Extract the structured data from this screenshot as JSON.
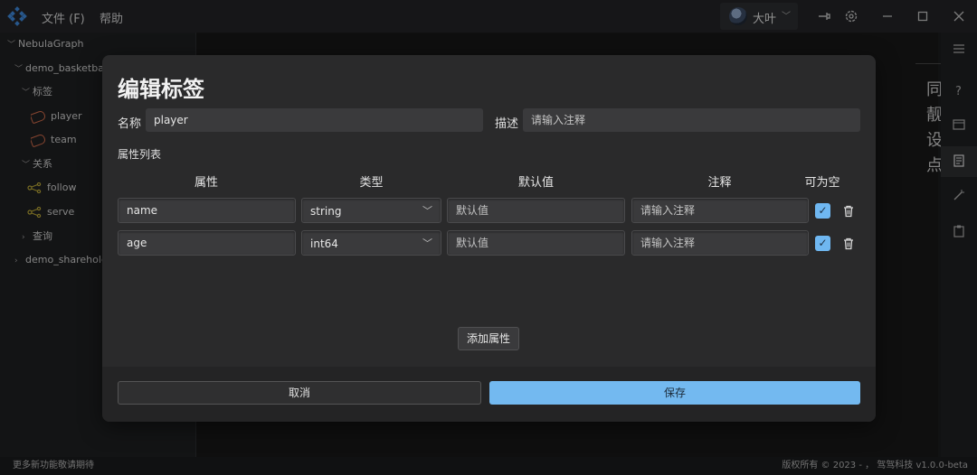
{
  "menu": {
    "file": "文件 (F)",
    "help": "帮助"
  },
  "user": {
    "name": "大叶"
  },
  "sidebar": {
    "root": "NebulaGraph",
    "space1": "demo_basketball",
    "tags_group": "标签",
    "tag1": "player",
    "tag2": "team",
    "edges_group": "关系",
    "edge1": "follow",
    "edge2": "serve",
    "query_group": "查询",
    "space2": "demo_shareholding"
  },
  "background_glyphs": [
    "同",
    "靓",
    "设",
    "点"
  ],
  "dialog": {
    "title": "编辑标签",
    "name_label": "名称",
    "name_value": "player",
    "desc_label": "描述",
    "desc_placeholder": "请输入注释",
    "props_label": "属性列表",
    "columns": [
      "属性",
      "类型",
      "默认值",
      "注释",
      "可为空"
    ],
    "rows": [
      {
        "name": "name",
        "type": "string",
        "default_placeholder": "默认值",
        "comment_placeholder": "请输入注释",
        "nullable": true
      },
      {
        "name": "age",
        "type": "int64",
        "default_placeholder": "默认值",
        "comment_placeholder": "请输入注释",
        "nullable": true
      }
    ],
    "add_button": "添加属性",
    "cancel": "取消",
    "save": "保存"
  },
  "status": {
    "left": "更多新功能敬请期待",
    "right": "版权所有 © 2023 - ，  驾驾科技  v1.0.0-beta"
  },
  "colors": {
    "accent": "#73b9f0",
    "tag_icon": "#d06b4a",
    "edge_icon": "#b9a636"
  },
  "icons": [
    "logo-icon",
    "pin-icon",
    "gear-icon",
    "minimize-icon",
    "maximize-icon",
    "close-icon",
    "trash-icon",
    "check-icon",
    "help-icon",
    "card-icon",
    "document-icon",
    "wand-icon",
    "clipboard-icon"
  ]
}
